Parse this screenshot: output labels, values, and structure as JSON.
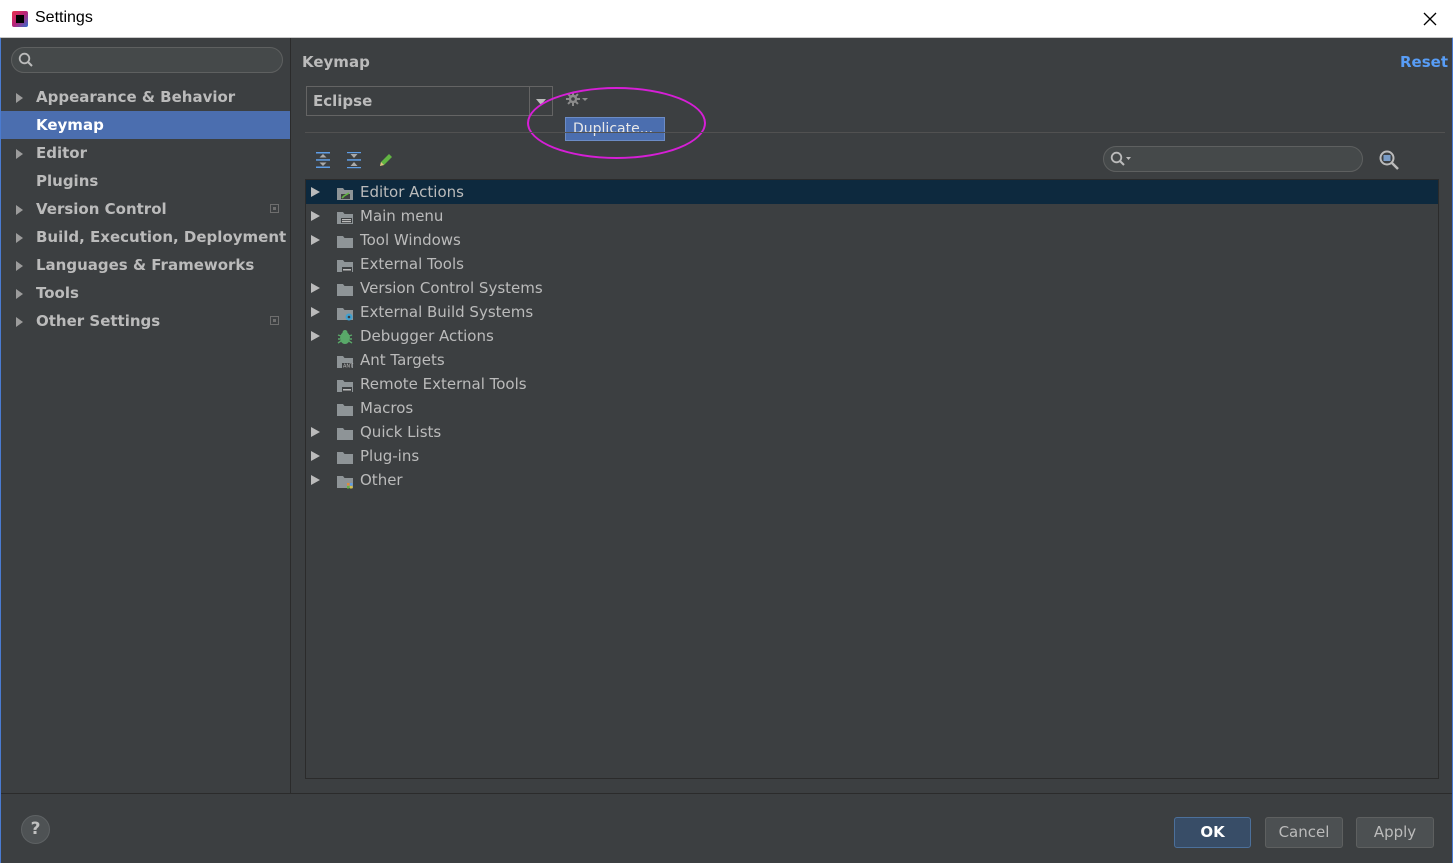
{
  "window": {
    "title": "Settings",
    "close_glyph": "✕"
  },
  "sidebar": {
    "search_placeholder": "",
    "items": [
      {
        "label": "Appearance & Behavior",
        "expandable": true,
        "selected": false,
        "project_level": false
      },
      {
        "label": "Keymap",
        "expandable": false,
        "selected": true,
        "project_level": false
      },
      {
        "label": "Editor",
        "expandable": true,
        "selected": false,
        "project_level": false
      },
      {
        "label": "Plugins",
        "expandable": false,
        "selected": false,
        "project_level": false
      },
      {
        "label": "Version Control",
        "expandable": true,
        "selected": false,
        "project_level": true
      },
      {
        "label": "Build, Execution, Deployment",
        "expandable": true,
        "selected": false,
        "project_level": false
      },
      {
        "label": "Languages & Frameworks",
        "expandable": true,
        "selected": false,
        "project_level": false
      },
      {
        "label": "Tools",
        "expandable": true,
        "selected": false,
        "project_level": false
      },
      {
        "label": "Other Settings",
        "expandable": true,
        "selected": false,
        "project_level": true
      }
    ]
  },
  "main": {
    "title": "Keymap",
    "reset_label": "Reset",
    "keymap_selected": "Eclipse",
    "gear_menu": {
      "items": [
        "Duplicate..."
      ]
    },
    "filter_placeholder": "",
    "tree": [
      {
        "label": "Editor Actions",
        "expandable": true,
        "icon": "editor-actions-icon",
        "selected": true
      },
      {
        "label": "Main menu",
        "expandable": true,
        "icon": "main-menu-folder-icon",
        "selected": false
      },
      {
        "label": "Tool Windows",
        "expandable": true,
        "icon": "folder-icon",
        "selected": false
      },
      {
        "label": "External Tools",
        "expandable": false,
        "icon": "external-tools-folder-icon",
        "selected": false
      },
      {
        "label": "Version Control Systems",
        "expandable": true,
        "icon": "folder-icon",
        "selected": false
      },
      {
        "label": "External Build Systems",
        "expandable": true,
        "icon": "build-systems-folder-icon",
        "selected": false
      },
      {
        "label": "Debugger Actions",
        "expandable": true,
        "icon": "bug-icon",
        "selected": false
      },
      {
        "label": "Ant Targets",
        "expandable": false,
        "icon": "ant-folder-icon",
        "selected": false
      },
      {
        "label": "Remote External Tools",
        "expandable": false,
        "icon": "remote-tools-folder-icon",
        "selected": false
      },
      {
        "label": "Macros",
        "expandable": false,
        "icon": "folder-icon",
        "selected": false
      },
      {
        "label": "Quick Lists",
        "expandable": true,
        "icon": "folder-icon",
        "selected": false
      },
      {
        "label": "Plug-ins",
        "expandable": true,
        "icon": "folder-icon",
        "selected": false
      },
      {
        "label": "Other",
        "expandable": true,
        "icon": "other-folder-icon",
        "selected": false
      }
    ]
  },
  "footer": {
    "help_label": "?",
    "ok_label": "OK",
    "cancel_label": "Cancel",
    "apply_label": "Apply"
  },
  "colors": {
    "background": "#3c3f41",
    "selection": "#4b6eaf",
    "tree_selection": "#0d293e",
    "link": "#589df6",
    "highlight_ellipse": "#d61fd6"
  }
}
